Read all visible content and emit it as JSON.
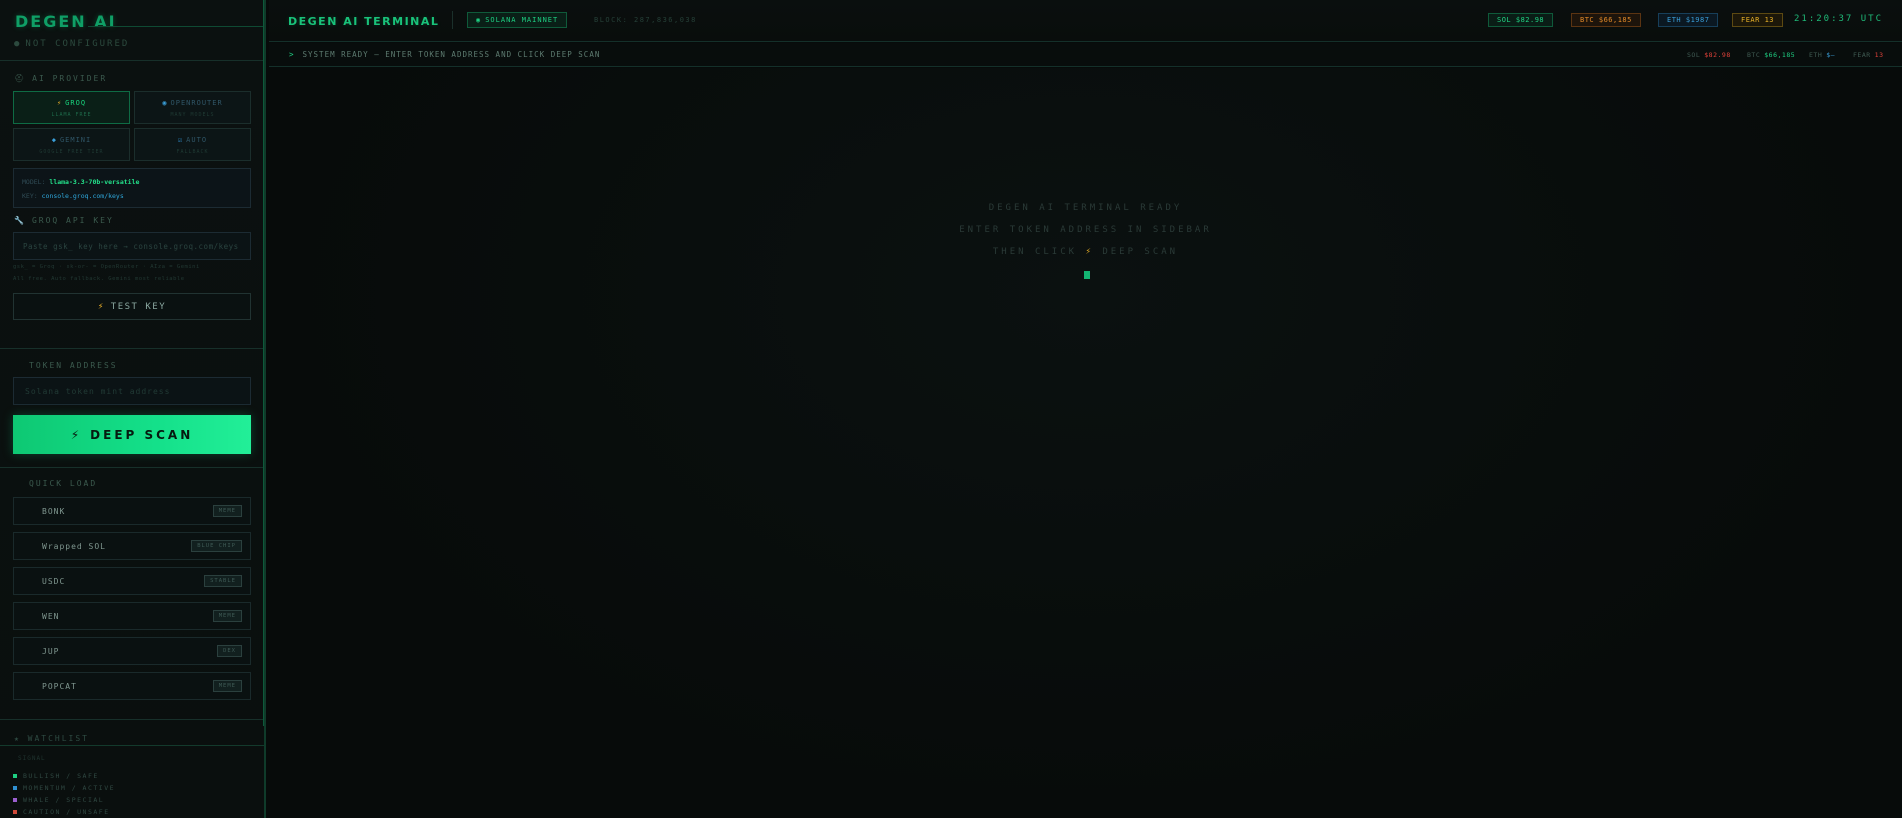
{
  "sidebar": {
    "brand": "DEGEN AI",
    "status": "NOT CONFIGURED",
    "ai_provider_label": "AI PROVIDER",
    "providers": [
      {
        "name": "GROQ",
        "sub": "LLAMA FREE",
        "icon": "lightning-icon"
      },
      {
        "name": "OPENROUTER",
        "sub": "MANY MODELS",
        "icon": "globe-icon"
      },
      {
        "name": "GEMINI",
        "sub": "GOOGLE FREE TIER",
        "icon": "diamond-icon"
      },
      {
        "name": "AUTO",
        "sub": "FALLBACK",
        "icon": "auto-icon"
      }
    ],
    "model_key_label": "MODEL:",
    "model_value": "llama-3.3-70b-versatile",
    "key_label": "KEY:",
    "key_link": "console.groq.com/keys",
    "api_key_label": "GROQ API KEY",
    "api_key_placeholder": "Paste gsk_ key here → console.groq.com/keys",
    "api_hint_1": "gsk_ = Groq · sk-or- = OpenRouter · AIza = Gemini",
    "api_hint_2": "All free. Auto fallback. Gemini most reliable",
    "test_key_label": "TEST KEY",
    "token_address_label": "TOKEN ADDRESS",
    "token_address_placeholder": "Solana token mint address",
    "deep_scan_label": "DEEP SCAN",
    "quick_load_label": "QUICK LOAD",
    "quick_load": [
      {
        "name": "BONK",
        "tag": "MEME"
      },
      {
        "name": "Wrapped SOL",
        "tag": "BLUE CHIP"
      },
      {
        "name": "USDC",
        "tag": "STABLE"
      },
      {
        "name": "WEN",
        "tag": "MEME"
      },
      {
        "name": "JUP",
        "tag": "DEX"
      },
      {
        "name": "POPCAT",
        "tag": "MEME"
      }
    ],
    "watchlist_label": "WATCHLIST",
    "legend_label": "SIGNAL",
    "legend": [
      {
        "label": "BULLISH / SAFE",
        "color": "#1ecf82"
      },
      {
        "label": "MOMENTUM / ACTIVE",
        "color": "#2f8fd0"
      },
      {
        "label": "WHALE / SPECIAL",
        "color": "#9b5fd0"
      },
      {
        "label": "CAUTION / UNSAFE",
        "color": "#d04a3a"
      }
    ]
  },
  "topbar": {
    "title": "DEGEN AI TERMINAL",
    "network": "SOLANA MAINNET",
    "block": "BLOCK: 287,836,038",
    "sol": "SOL $82.98",
    "btc": "BTC $66,185",
    "eth": "ETH $1987",
    "fear": "FEAR 13",
    "clock": "21:20:37 UTC"
  },
  "statusbar": {
    "text": "SYSTEM READY — ENTER TOKEN ADDRESS AND CLICK DEEP SCAN",
    "sol_label": "SOL",
    "sol_value": "$82.98",
    "btc_label": "BTC",
    "btc_value": "$66,185",
    "eth_label": "ETH",
    "eth_value": "$—",
    "fear_label": "FEAR",
    "fear_value": "13"
  },
  "main": {
    "line1": "DEGEN AI TERMINAL READY",
    "line2": "ENTER TOKEN ADDRESS IN SIDEBAR",
    "line3_pre": "THEN CLICK",
    "line3_post": "DEEP SCAN"
  },
  "colors": {
    "accent": "#14e08a",
    "btc": "#e28a28",
    "eth": "#3a9ed8",
    "fear": "#e9b228",
    "down": "#e2423a"
  }
}
